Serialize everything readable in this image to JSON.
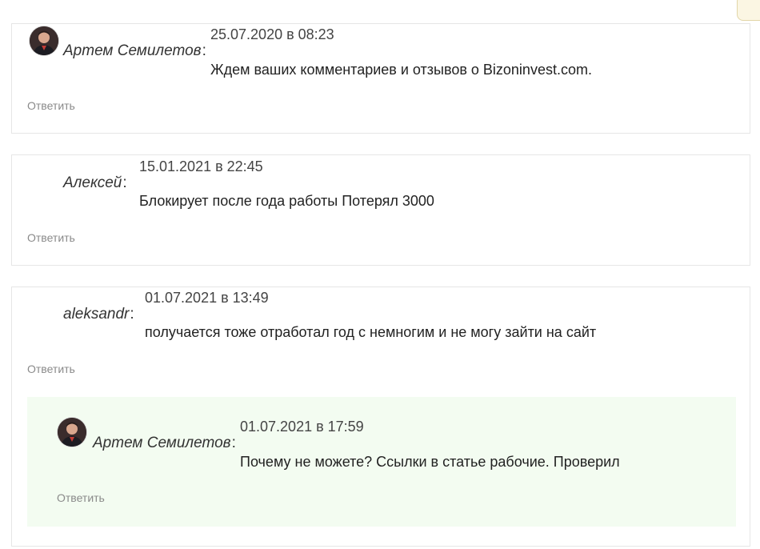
{
  "comments": [
    {
      "author": "Артем Семилетов",
      "date": "25.07.2020 в 08:23",
      "text": "Ждем ваших комментариев и отзывов о Bizoninvest.com.",
      "reply_label": "Ответить"
    },
    {
      "author": "Алексей",
      "date": "15.01.2021 в 22:45",
      "text": "Блокирует после года работы Потерял 3000",
      "reply_label": "Ответить"
    },
    {
      "author": "aleksandr",
      "date": "01.07.2021 в 13:49",
      "text": "получается тоже отработал год с немногим и не могу зайти на сайт",
      "reply_label": "Ответить",
      "replies": [
        {
          "author": "Артем Семилетов",
          "date": "01.07.2021 в 17:59",
          "text": "Почему не можете? Ссылки в статье рабочие. Проверил",
          "reply_label": "Ответить"
        }
      ]
    }
  ],
  "colors": {
    "border": "#e6e6e6",
    "reply_background": "#f3fcf1",
    "link": "#8a8a8a"
  }
}
